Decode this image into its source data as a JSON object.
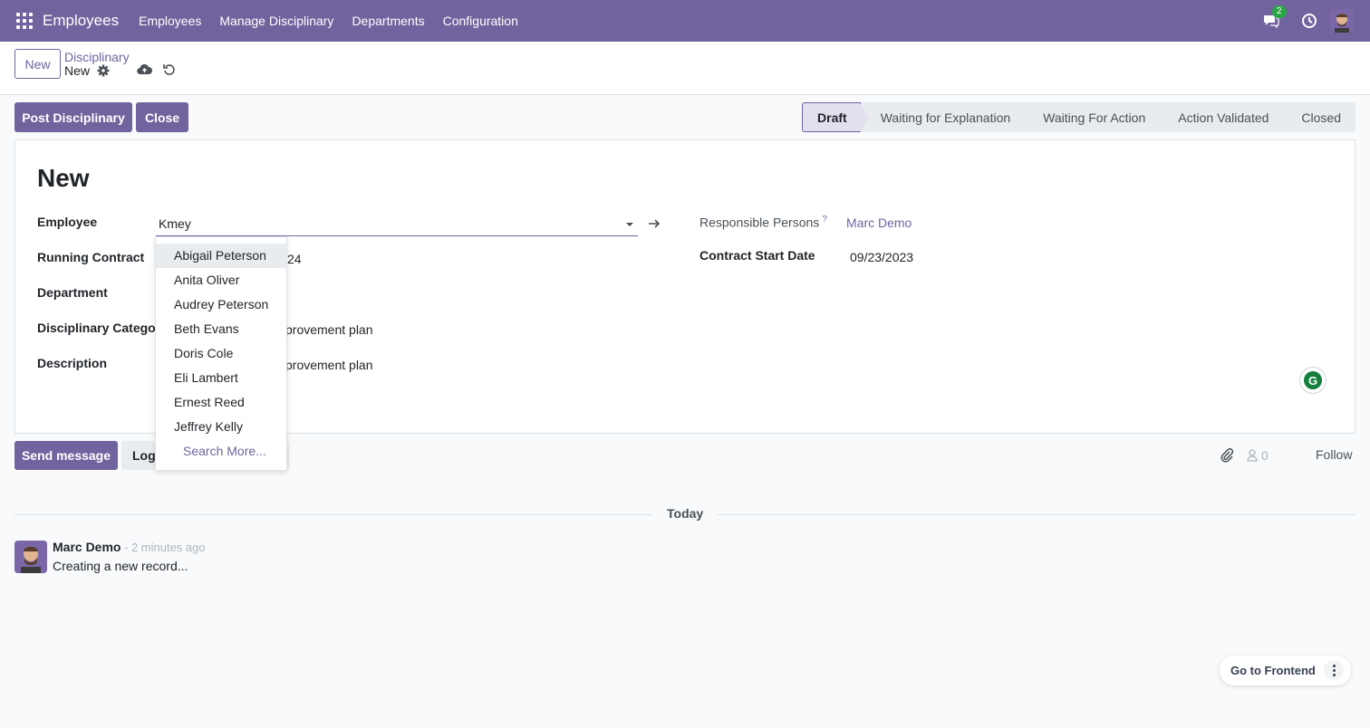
{
  "navbar": {
    "brand": "Employees",
    "menu": [
      "Employees",
      "Manage Disciplinary",
      "Departments",
      "Configuration"
    ],
    "chat_count": "2"
  },
  "control": {
    "new_label": "New",
    "breadcrumb_parent": "Disciplinary",
    "breadcrumb_current": "New"
  },
  "actions": {
    "post_label": "Post Disciplinary",
    "close_label": "Close"
  },
  "stages": [
    "Draft",
    "Waiting for Explanation",
    "Waiting For Action",
    "Action Validated",
    "Closed"
  ],
  "form": {
    "title": "New",
    "employee_label": "Employee",
    "employee_value": "Kmey",
    "running_contract_label": "Running Contract",
    "running_contract_value_partial": "24",
    "department_label": "Department",
    "category_label": "Disciplinary Categor",
    "category_value_partial": "provement plan",
    "description_label": "Description",
    "description_value_partial": "provement plan",
    "responsible_label": "Responsible Persons",
    "responsible_help": "?",
    "responsible_value": "Marc Demo",
    "contract_start_label": "Contract Start Date",
    "contract_start_value": "09/23/2023"
  },
  "dropdown": {
    "items": [
      "Abigail Peterson",
      "Anita Oliver",
      "Audrey Peterson",
      "Beth Evans",
      "Doris Cole",
      "Eli Lambert",
      "Ernest Reed",
      "Jeffrey Kelly"
    ],
    "search_more": "Search More..."
  },
  "chatter": {
    "send_label": "Send message",
    "log_label": "Log",
    "follower_count": "0",
    "follow_label": "Follow",
    "today_label": "Today",
    "message": {
      "author": "Marc Demo",
      "time": "- 2 minutes ago",
      "body": "Creating a new record..."
    }
  },
  "frontend": {
    "label": "Go to Frontend"
  },
  "colors": {
    "brand": "#71639e",
    "badge": "#28a745"
  }
}
